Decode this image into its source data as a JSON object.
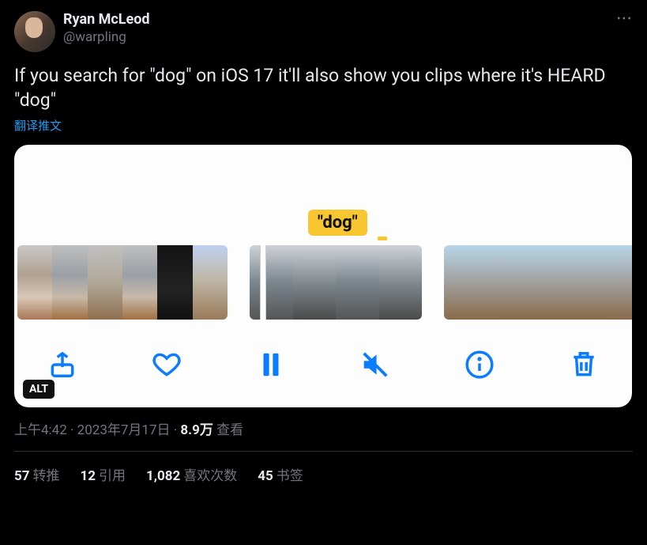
{
  "author": {
    "display_name": "Ryan McLeod",
    "handle": "@warpling"
  },
  "body_text": "If you search for \"dog\" on iOS 17 it'll also show you clips where it's HEARD \"dog\"",
  "translate_label": "翻译推文",
  "media": {
    "caption_bubble": "\"dog\"",
    "alt_badge": "ALT"
  },
  "meta": {
    "time": "上午4:42",
    "dot1": " · ",
    "date": "2023年7月17日",
    "dot2": " · ",
    "views_number": "8.9万",
    "views_label": " 查看"
  },
  "stats": {
    "retweets_n": "57",
    "retweets_label": "转推",
    "quotes_n": "12",
    "quotes_label": "引用",
    "likes_n": "1,082",
    "likes_label": "喜欢次数",
    "bookmarks_n": "45",
    "bookmarks_label": "书签"
  }
}
